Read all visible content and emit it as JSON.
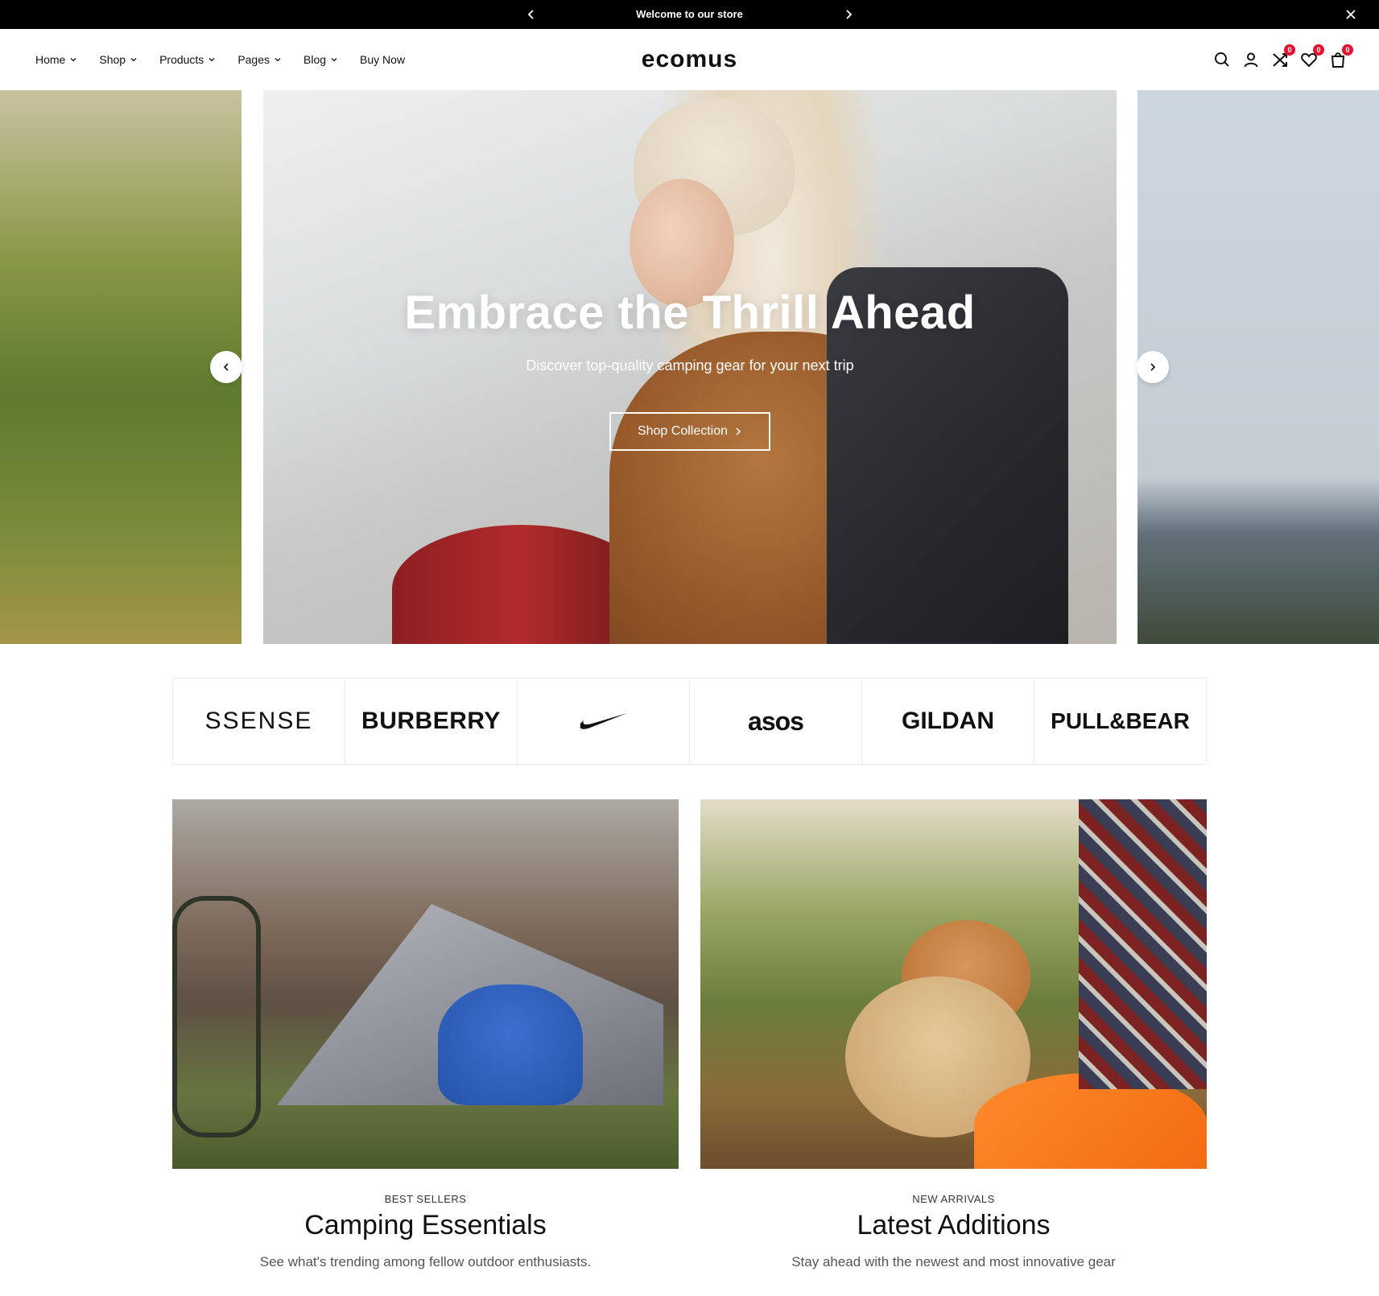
{
  "announcement": {
    "message": "Welcome to our store",
    "prev_icon": "chevron-left-icon",
    "next_icon": "chevron-right-icon",
    "close_icon": "close-icon"
  },
  "header": {
    "logo": "ecomus",
    "nav": [
      {
        "label": "Home",
        "has_dropdown": true
      },
      {
        "label": "Shop",
        "has_dropdown": true
      },
      {
        "label": "Products",
        "has_dropdown": true
      },
      {
        "label": "Pages",
        "has_dropdown": true
      },
      {
        "label": "Blog",
        "has_dropdown": true
      },
      {
        "label": "Buy Now",
        "has_dropdown": false
      }
    ],
    "icons": {
      "search": "search-icon",
      "account": "user-icon",
      "compare": "compare-icon",
      "compare_count": "0",
      "wishlist": "heart-icon",
      "wishlist_count": "0",
      "cart": "cart-icon",
      "cart_count": "0"
    },
    "badge_color": "#e8112d"
  },
  "hero": {
    "title": "Embrace the Thrill Ahead",
    "subtitle": "Discover top-quality camping gear for your next trip",
    "button_label": "Shop Collection"
  },
  "brands": [
    "SSENSE",
    "BURBERRY",
    "NIKE",
    "asos",
    "GILDAN",
    "PULL&BEAR"
  ],
  "collections": [
    {
      "eyebrow": "BEST SELLERS",
      "title": "Camping Essentials",
      "description": "See what's trending among fellow outdoor enthusiasts."
    },
    {
      "eyebrow": "NEW ARRIVALS",
      "title": "Latest Additions",
      "description": "Stay ahead with the newest and most innovative gear"
    }
  ]
}
